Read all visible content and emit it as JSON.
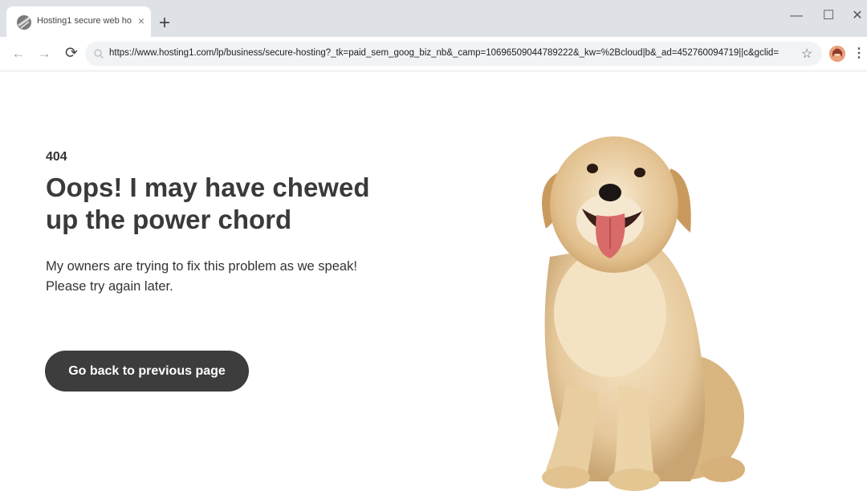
{
  "browser": {
    "tab": {
      "title": "Hosting1 secure web ho...",
      "close_glyph": "×",
      "favicon": "globe-icon"
    },
    "new_tab_glyph": "+",
    "window_controls": {
      "minimize": "—",
      "maximize": "☐",
      "close": "✕"
    },
    "nav": {
      "back": "←",
      "forward": "→",
      "reload": "⟳"
    },
    "address_bar": {
      "url": "https://www.hosting1.com/lp/business/secure-hosting?_tk=paid_sem_goog_biz_nb&_camp=10696509044789222&_kw=%2Bcloud|b&_ad=452760094719||c&gclid="
    },
    "bookmark_glyph": "☆",
    "menu_glyph": "⋮"
  },
  "page": {
    "error_code": "404",
    "headline": "Oops! I may have chewed up the power chord",
    "message": "My owners are trying to fix this problem as we speak! Please try again later.",
    "button_label": "Go back to previous page",
    "colors": {
      "button_bg": "#3d3d3d",
      "text": "#333333",
      "tabbar_bg": "#dee1e6",
      "omnibox_bg": "#f1f3f4"
    }
  }
}
